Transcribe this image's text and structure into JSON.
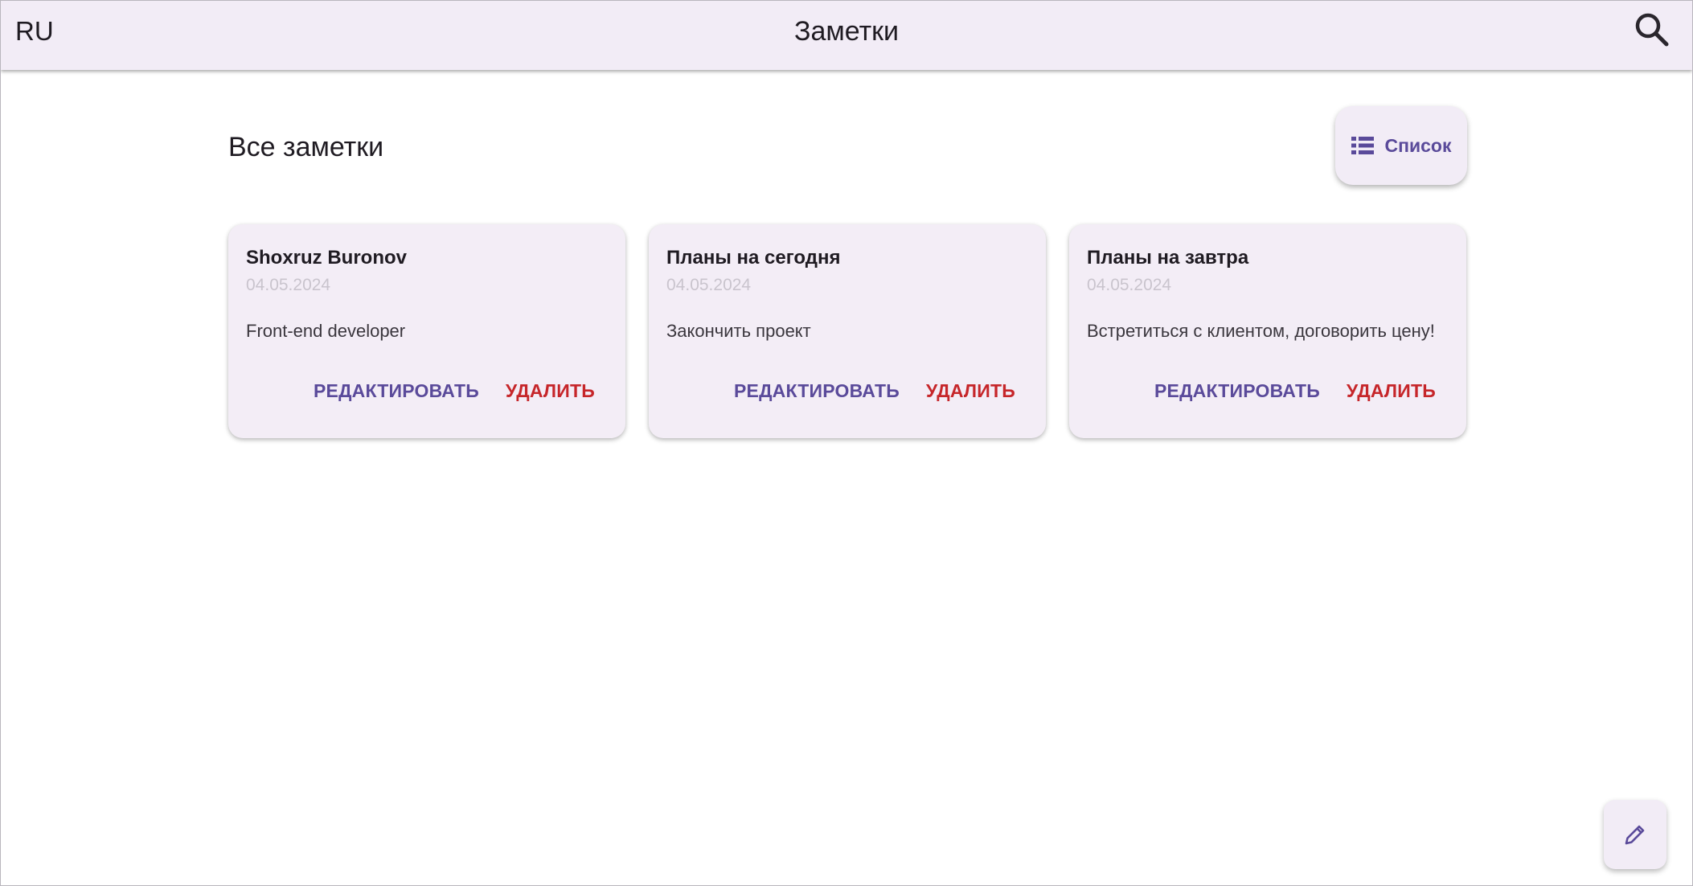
{
  "appbar": {
    "language": "RU",
    "title": "Заметки",
    "search_icon": "search-icon"
  },
  "main": {
    "section_title": "Все заметки",
    "view_toggle": {
      "label": "Список",
      "icon": "list-icon"
    },
    "notes": [
      {
        "title": "Shoxruz Buronov",
        "date": "04.05.2024",
        "text": "Front-end developer",
        "edit_label": "РЕДАКТИРОВАТЬ",
        "delete_label": "УДАЛИТЬ"
      },
      {
        "title": "Планы на сегодня",
        "date": "04.05.2024",
        "text": "Закончить проект",
        "edit_label": "РЕДАКТИРОВАТЬ",
        "delete_label": "УДАЛИТЬ"
      },
      {
        "title": "Планы на завтра",
        "date": "04.05.2024",
        "text": "Встретиться с клиентом, договорить цену!",
        "edit_label": "РЕДАКТИРОВАТЬ",
        "delete_label": "УДАЛИТЬ"
      }
    ]
  },
  "fab": {
    "icon": "pencil-icon"
  },
  "colors": {
    "surface": "#f2ecf6",
    "primary": "#5a4a9a",
    "danger": "#c6262a",
    "muted_date": "#c9c4cd"
  }
}
